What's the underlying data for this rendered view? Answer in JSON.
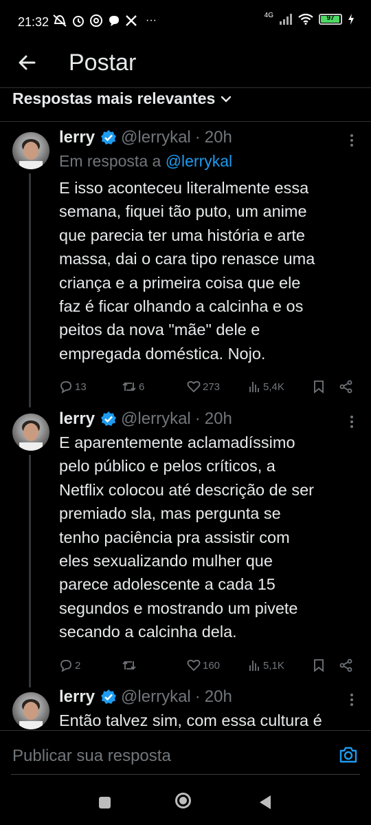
{
  "status_bar": {
    "time": "21:32",
    "network": "4G",
    "battery": "97",
    "battery_level": 0.97,
    "more": "···"
  },
  "header": {
    "title": "Postar",
    "sort_label": "Respostas mais relevantes"
  },
  "tweets": [
    {
      "name": "lerry",
      "handle": "@lerrykal",
      "dot": "·",
      "time": "20h",
      "reply_prefix": "Em resposta a",
      "reply_handle": "@lerrykal",
      "lines": [
        "E isso aconteceu literalmente essa",
        "semana, fiquei tão puto, um anime",
        "que parecia ter uma história e arte",
        "massa, dai o cara tipo renasce uma",
        "criança e a primeira coisa que ele",
        "faz é ficar olhando a calcinha e os",
        "peitos da nova \"mãe\" dele e",
        "empregada doméstica. Nojo."
      ],
      "replies": "13",
      "retweets": "6",
      "likes": "273",
      "views": "5,4K"
    },
    {
      "name": "lerry",
      "handle": "@lerrykal",
      "dot": "·",
      "time": "20h",
      "lines": [
        "E aparentemente aclamadíssimo",
        "pelo público e pelos críticos, a",
        "Netflix colocou até descrição de ser",
        "premiado sla, mas pergunta se",
        "tenho paciência pra assistir com",
        "eles sexualizando mulher que",
        "parece adolescente a cada 15",
        "segundos e mostrando um pivete",
        "secando a calcinha dela."
      ],
      "replies": "2",
      "retweets": "",
      "likes": "160",
      "views": "5,1K"
    },
    {
      "name": "lerry",
      "handle": "@lerrykal",
      "dot": "·",
      "time": "20h",
      "lines": [
        "Então talvez sim, com essa cultura é"
      ]
    }
  ],
  "compose": {
    "placeholder": "Publicar sua resposta"
  },
  "colors": {
    "background": "#000000",
    "text": "#e7e9ea",
    "muted": "#71767b",
    "accent": "#1d9bf0"
  },
  "icons": [
    "back-arrow-icon",
    "chevron-down-icon",
    "verified-icon",
    "more-icon",
    "reply-icon",
    "retweet-icon",
    "like-icon",
    "views-icon",
    "bookmark-icon",
    "share-icon",
    "camera-icon"
  ]
}
